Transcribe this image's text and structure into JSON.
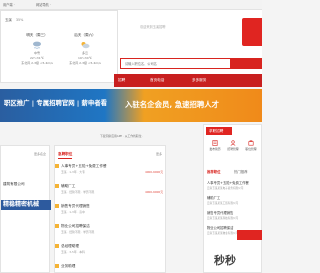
{
  "topbar": {
    "user": "用户端 ·",
    "mobile": "网站导航 ·"
  },
  "weather": {
    "location_label": "玉溪",
    "humidity": "35%",
    "days": [
      {
        "name": "明天（周三）",
        "cond": "中雪",
        "temp": "22～31℃",
        "wind": "东北风 2-3级 <5.4m/s"
      },
      {
        "name": "后天（周六）",
        "cond": "多云",
        "temp": "19～34℃",
        "wind": "东北风 2-3级 <5.4m/s"
      }
    ]
  },
  "header": {
    "ad_text": "欢迎来到玉溪招聘",
    "search_placeholder": "请输入职位名、公司名",
    "search_button": "搜索"
  },
  "nav": {
    "items": [
      "招聘",
      "首页电话",
      "多多服务"
    ]
  },
  "banner": {
    "left": "职区推广 | 专属招聘官网 | 薪申者看",
    "right": "入驻名企会员, 急速招聘人才"
  },
  "util_bar": "下载洞察应用APP · 从工作找职位 ·",
  "left_card": {
    "more": "更多名企",
    "company": "建筑有限公司",
    "banner_text": "精稳精密机械"
  },
  "job_panel": {
    "tab": "急聘职位",
    "more": "更多",
    "jobs": [
      {
        "title": "人事专员+五险+免费工作餐",
        "meta": "玉溪 · 1-3年 · 大专",
        "salary": "4000-6000元"
      },
      {
        "title": "辅助厂工",
        "meta": "玉溪 · 经验不限 · 学历不限",
        "salary": "4000-6000元"
      },
      {
        "title": "销售专员代理销售",
        "meta": "玉溪 · 1-3年 · 高中",
        "salary": ""
      },
      {
        "title": "物业公司招聘保洁",
        "meta": "玉溪 · 经验不限 · 学历不限",
        "salary": ""
      },
      {
        "title": "总经理助理",
        "meta": "玉溪 · 3-5年 · 本科",
        "salary": ""
      },
      {
        "title": "业务助理",
        "meta": "",
        "salary": ""
      }
    ]
  },
  "right_panel": {
    "hiring_btn": "求职招聘",
    "icons": [
      {
        "label": "发布简历",
        "icon": "resume-icon"
      },
      {
        "label": "招聘管理",
        "icon": "recruit-icon"
      },
      {
        "label": "职位管理",
        "icon": "manage-icon"
      }
    ],
    "tabs": [
      "推荐职位",
      "热门推荐"
    ],
    "items": [
      {
        "title": "人事专员+五险+免费工作餐",
        "sub": "云南玉溪某某电子商务有限公司"
      },
      {
        "title": "辅助厂工",
        "sub": "云南玉溪某某工贸有限公司"
      },
      {
        "title": "销售专员代理销售",
        "sub": "云南玉溪某某科技有限公司"
      },
      {
        "title": "物业公司招聘保洁",
        "sub": "云南玉溪某某物业有限公司"
      }
    ]
  },
  "watermark": "秒秒",
  "colors": {
    "brand_red": "#d8241f",
    "nav_red": "#c81f1f",
    "banner_orange": "#f0a022",
    "banner_blue": "#1f76c4"
  }
}
